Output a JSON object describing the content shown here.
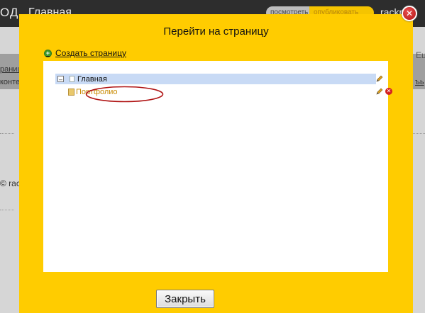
{
  "app": {
    "logo_text": "ОД",
    "home_tab": "Главная",
    "view_button": "посмотреть",
    "publish_button": "опубликовать",
    "user_name": "rackn"
  },
  "background": {
    "link_text": "раницы",
    "content_text": "конте",
    "copyright_text": "© rac",
    "right_text": "Ец",
    "right_link": "ъь"
  },
  "dialog": {
    "title": "Перейти на страницу",
    "create_link": "Создать страницу",
    "close_button": "Закрыть",
    "tree": [
      {
        "label": "Главная",
        "expander": "–",
        "selected": true
      },
      {
        "label": "Портфолио",
        "selected": false
      }
    ]
  },
  "colors": {
    "modal_bg": "#ffcc00",
    "selected_row": "#c8daf5",
    "child_label": "#c88a00",
    "annotation": "#b01414"
  }
}
